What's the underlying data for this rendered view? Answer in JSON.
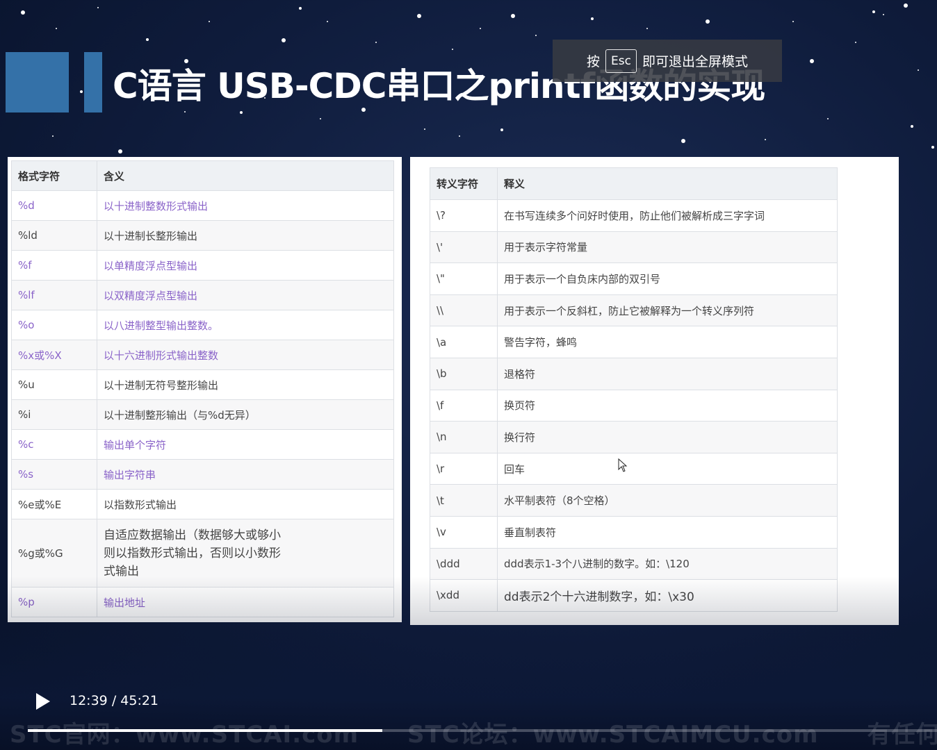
{
  "title": "C语言 USB-CDC串口之printf函数的实现",
  "esc_banner": {
    "prefix": "按",
    "key": "Esc",
    "suffix": "即可退出全屏模式"
  },
  "format_table": {
    "headers": [
      "格式字符",
      "含义"
    ],
    "rows": [
      {
        "code": "%d",
        "meaning": "以十进制整数形式输出",
        "purple": true
      },
      {
        "code": "%ld",
        "meaning": "以十进制长整形输出",
        "purple": false
      },
      {
        "code": "%f",
        "meaning": "以单精度浮点型输出",
        "purple": true
      },
      {
        "code": "%lf",
        "meaning": "以双精度浮点型输出",
        "purple": true
      },
      {
        "code": "%o",
        "meaning": "以八进制整型输出整数。",
        "purple": true
      },
      {
        "code": "%x或%X",
        "meaning": "以十六进制形式输出整数",
        "purple": true
      },
      {
        "code": "%u",
        "meaning": "以十进制无符号整形输出",
        "purple": false
      },
      {
        "code": "%i",
        "meaning": "以十进制整形输出（与%d无异）",
        "purple": false
      },
      {
        "code": "%c",
        "meaning": "输出单个字符",
        "purple": true
      },
      {
        "code": "%s",
        "meaning": "输出字符串",
        "purple": true
      },
      {
        "code": "%e或%E",
        "meaning": "以指数形式输出",
        "purple": false
      },
      {
        "code": "%g或%G",
        "meaning": "自适应数据输出（数据够大或够小则以指数形式输出，否则以小数形式输出",
        "purple": false
      },
      {
        "code": "%p",
        "meaning": "输出地址",
        "purple": true
      }
    ]
  },
  "escape_table": {
    "headers": [
      "转义字符",
      "释义"
    ],
    "rows": [
      {
        "code": "\\?",
        "meaning": "在书写连续多个问好时使用，防止他们被解析成三字字词"
      },
      {
        "code": "\\'",
        "meaning": "用于表示字符常量"
      },
      {
        "code": "\\\"",
        "meaning": "用于表示一个自负床内部的双引号"
      },
      {
        "code": "\\\\",
        "meaning": "用于表示一个反斜杠，防止它被解释为一个转义序列符"
      },
      {
        "code": "\\a",
        "meaning": "警告字符，蜂鸣"
      },
      {
        "code": "\\b",
        "meaning": "退格符"
      },
      {
        "code": "\\f",
        "meaning": "换页符"
      },
      {
        "code": "\\n",
        "meaning": "换行符"
      },
      {
        "code": "\\r",
        "meaning": "回车"
      },
      {
        "code": "\\t",
        "meaning": "水平制表符（8个空格）"
      },
      {
        "code": "\\v",
        "meaning": "垂直制表符"
      },
      {
        "code": "\\ddd",
        "meaning": "ddd表示1-3个八进制的数字。如：\\120"
      },
      {
        "code": "\\xdd",
        "meaning": "dd表示2个十六进制数字，如：\\x30"
      }
    ]
  },
  "player": {
    "current_time": "12:39",
    "separator": "/",
    "total_time": "45:21",
    "progress": 0.39
  },
  "footer": "STC官网：www.STCAI.com　　STC论坛：www.STCAIMCU.com　　有任何疑问都可以在论坛"
}
